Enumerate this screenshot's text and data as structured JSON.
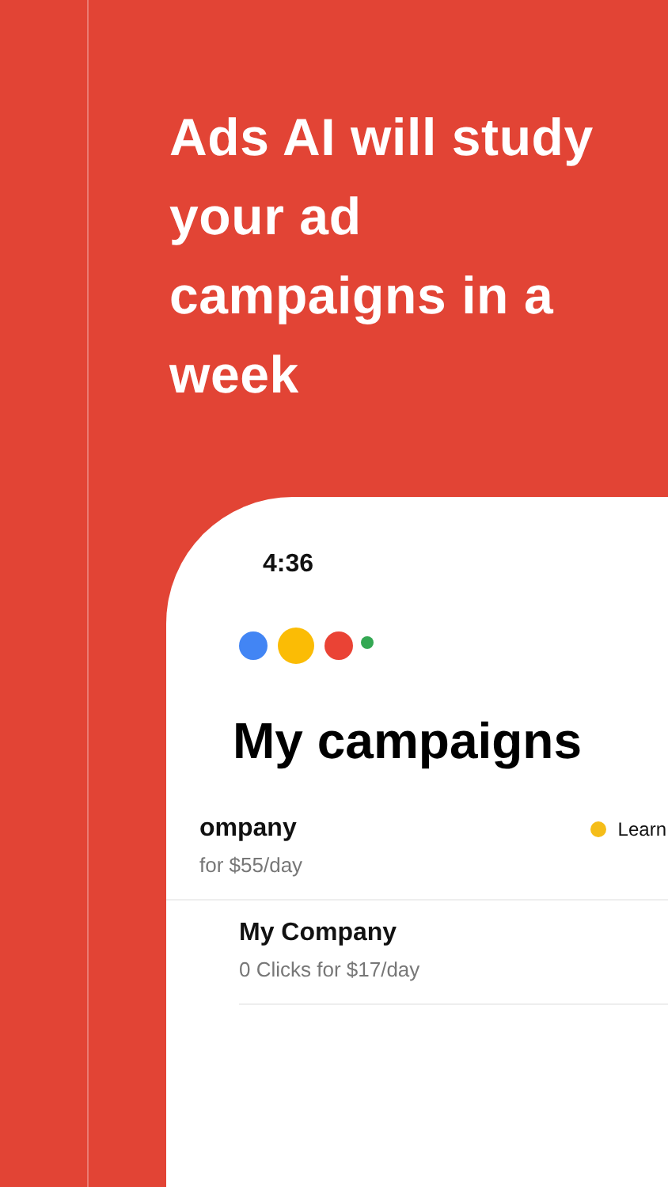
{
  "headline": "Ads AI will study your ad campaigns in a week",
  "phone": {
    "status_time": "4:36",
    "title": "My campaigns",
    "campaigns": [
      {
        "name": "ompany",
        "subtitle": "for $55/day",
        "swiped": true,
        "status": {
          "label": "Learn",
          "color": "#f5bd18"
        }
      },
      {
        "name": "My Company",
        "subtitle": "0 Clicks for $17/day",
        "swiped": false
      }
    ]
  }
}
